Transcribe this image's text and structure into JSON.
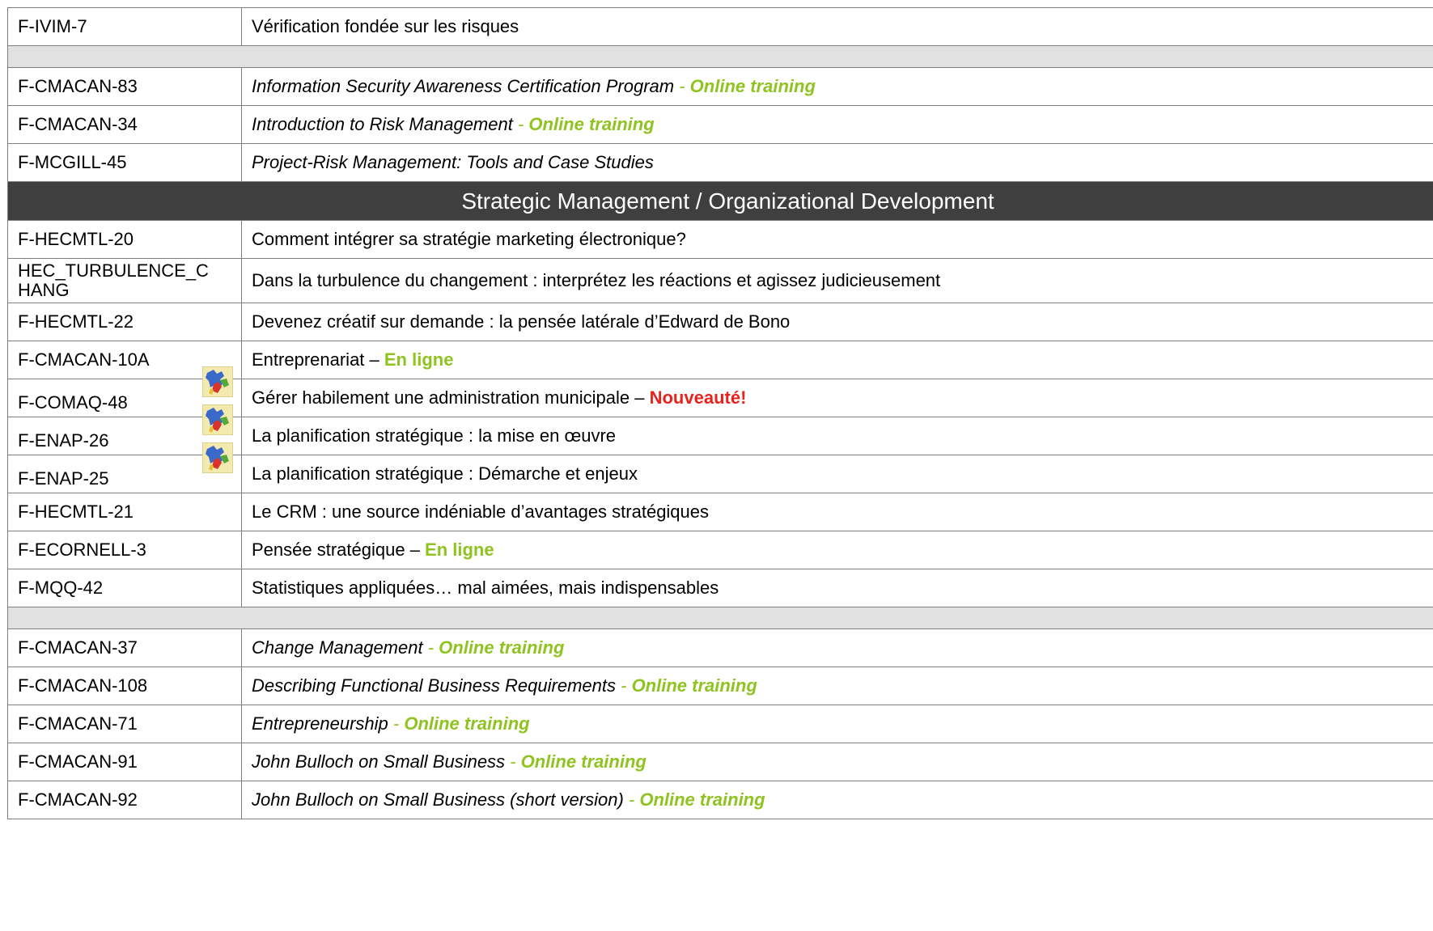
{
  "rows": [
    {
      "code": "F-IVIM-7",
      "desc": "Vérification fondée sur les risques"
    },
    {
      "code": "F-CMACAN-83",
      "desc": "Information Security Awareness Certification Program",
      "sep": " - ",
      "tag": "Online  training"
    },
    {
      "code": "F-CMACAN-34",
      "desc": "Introduction to Risk Management",
      "sep": " - ",
      "tag": "Online  training"
    },
    {
      "code": "F-MCGILL-45",
      "desc": "Project-Risk Management: Tools and Case Studies"
    },
    {
      "section_title": "Strategic Management / Organizational Development"
    },
    {
      "code": "F-HECMTL-20",
      "desc": "Comment intégrer sa stratégie marketing électronique?"
    },
    {
      "code": "HEC_TURBULENCE_CHANG",
      "code_line1": "HEC_TURBULENCE_C",
      "code_line2": "HANG",
      "desc": "Dans la turbulence du changement : interprétez les réactions et agissez judicieusement"
    },
    {
      "code": "F-HECMTL-22",
      "desc": "Devenez créatif sur demande : la pensée latérale d’Edward de Bono"
    },
    {
      "code": "F-CMACAN-10A",
      "desc": "Entreprenariat – ",
      "tag": "En ligne"
    },
    {
      "code": "F-COMAQ-48",
      "desc": "Gérer habilement une administration municipale – ",
      "tag": "Nouveauté!",
      "icon": "quebec-map-icon"
    },
    {
      "code": "F-ENAP-26",
      "desc": "La planification stratégique : la mise en œuvre",
      "icon": "quebec-map-icon"
    },
    {
      "code": "F-ENAP-25",
      "desc": "La planification stratégique : Démarche et enjeux",
      "icon": "quebec-map-icon"
    },
    {
      "code": "F-HECMTL-21",
      "desc": "Le CRM : une source indéniable d’avantages stratégiques"
    },
    {
      "code": "F-ECORNELL-3",
      "desc": "Pensée stratégique – ",
      "tag": "En ligne"
    },
    {
      "code": "F-MQQ-42",
      "desc": "Statistiques appliquées… mal aimées, mais indispensables"
    },
    {
      "code": "F-CMACAN-37",
      "desc": "Change Management",
      "sep": " - ",
      "tag": "Online  training"
    },
    {
      "code": "F-CMACAN-108",
      "desc": "Describing Functional Business Requirements",
      "sep": " - ",
      "tag": "Online  training"
    },
    {
      "code": "F-CMACAN-71",
      "desc": "Entrepreneurship",
      "sep": " - ",
      "tag": "Online  training"
    },
    {
      "code": "F-CMACAN-91",
      "desc": "John Bulloch on Small Business",
      "sep": " - ",
      "tag": "Online  training"
    },
    {
      "code": "F-CMACAN-92",
      "desc": "John Bulloch on Small Business (short version)",
      "sep": " - ",
      "tag": "Online  training"
    }
  ],
  "colors": {
    "online_tag": "#8fc31f",
    "new_tag": "#e8231d",
    "header_bg": "#3f3f3f",
    "gap_bg": "#e1e1e1"
  }
}
